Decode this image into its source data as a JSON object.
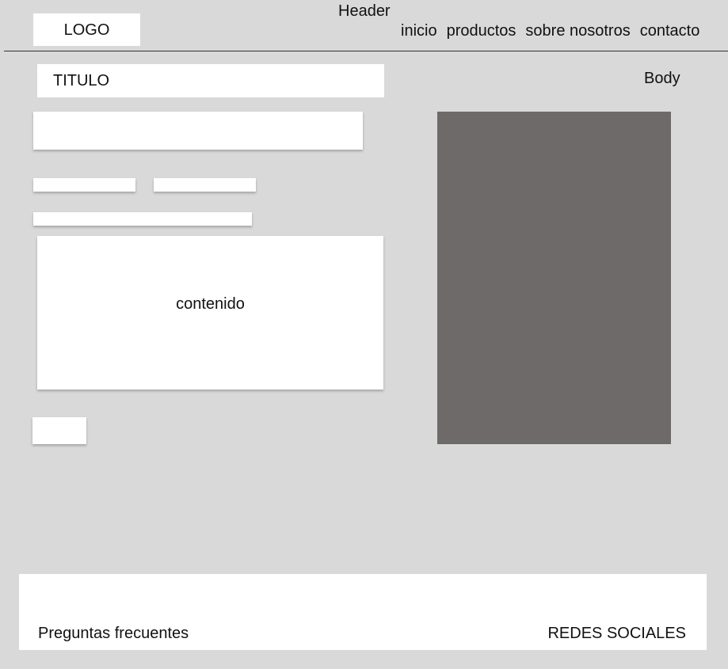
{
  "header": {
    "label": "Header",
    "logo": "LOGO",
    "nav": [
      "inicio",
      "productos",
      "sobre nosotros",
      "contacto"
    ]
  },
  "body": {
    "label": "Body",
    "title": "TITULO",
    "content_label": "contenido"
  },
  "footer": {
    "faq": "Preguntas frecuentes",
    "social": "REDES SOCIALES"
  },
  "colors": {
    "background": "#d9d9d9",
    "block": "#ffffff",
    "image_placeholder": "#6f6a6a"
  }
}
